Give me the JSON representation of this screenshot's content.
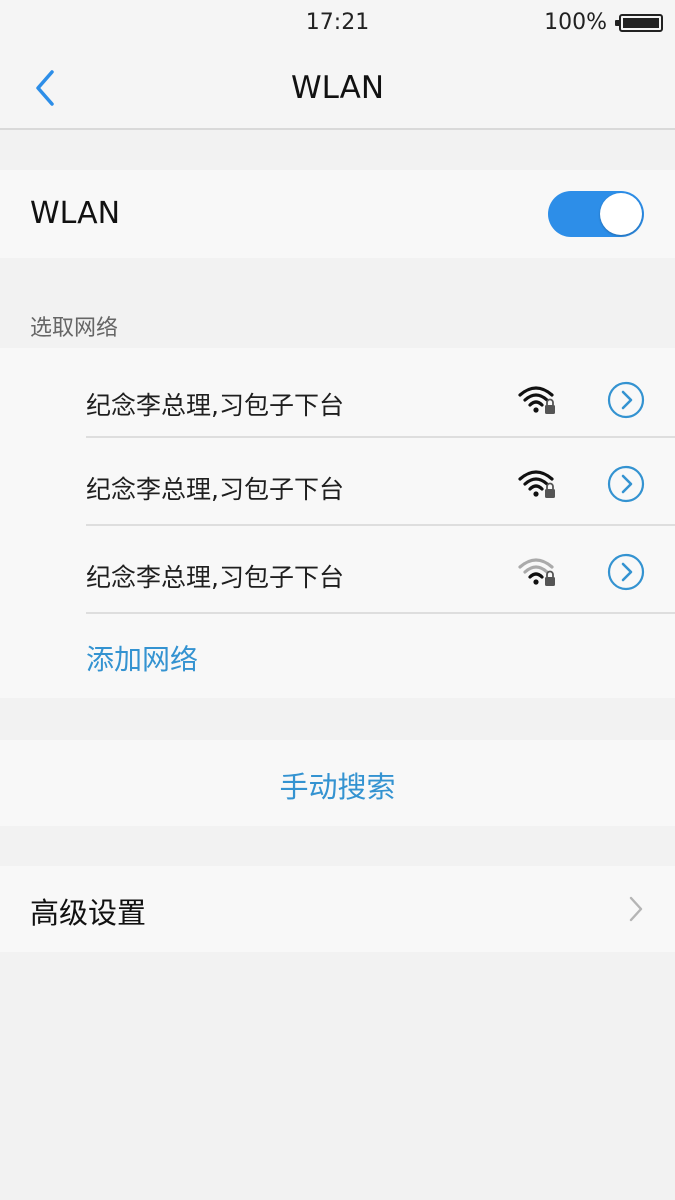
{
  "status_bar": {
    "time": "17:21",
    "battery_percent": "100%"
  },
  "nav": {
    "title": "WLAN",
    "back_icon": "chevron-left-icon"
  },
  "wlan_switch": {
    "label": "WLAN",
    "enabled": true,
    "accent_color": "#2d8ee8"
  },
  "network_section": {
    "header": "选取网络",
    "networks": [
      {
        "name": "纪念李总理,习包子下台",
        "signal_strength": "strong",
        "secured": true,
        "icon": "wifi-lock-icon"
      },
      {
        "name": "纪念李总理,习包子下台",
        "signal_strength": "strong",
        "secured": true,
        "icon": "wifi-lock-icon"
      },
      {
        "name": "纪念李总理,习包子下台",
        "signal_strength": "weak",
        "secured": true,
        "icon": "wifi-lock-icon"
      }
    ],
    "add_network_label": "添加网络",
    "link_color": "#3493d1"
  },
  "manual_search": {
    "label": "手动搜索"
  },
  "advanced": {
    "label": "高级设置",
    "icon": "chevron-right-icon"
  }
}
